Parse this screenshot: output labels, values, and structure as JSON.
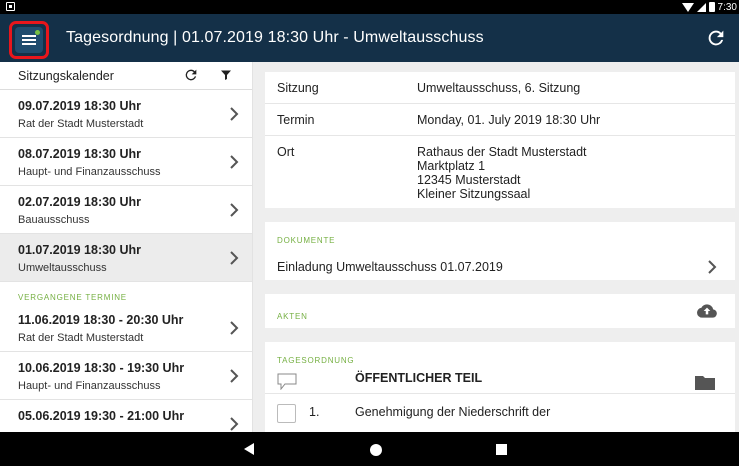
{
  "status_bar": {
    "time": "7:30"
  },
  "app_bar": {
    "title": "Tagesordnung | 01.07.2019 18:30 Uhr - Umweltausschuss"
  },
  "sidebar": {
    "title": "Sitzungskalender",
    "upcoming": [
      {
        "date": "09.07.2019 18:30 Uhr",
        "body": "Rat der Stadt Musterstadt"
      },
      {
        "date": "08.07.2019 18:30 Uhr",
        "body": "Haupt- und Finanzausschuss"
      },
      {
        "date": "02.07.2019 18:30 Uhr",
        "body": "Bauausschuss"
      },
      {
        "date": "01.07.2019 18:30 Uhr",
        "body": "Umweltausschuss",
        "selected": true
      }
    ],
    "past_label": "VERGANGENE TERMINE",
    "past": [
      {
        "date": "11.06.2019 18:30 - 20:30 Uhr",
        "body": "Rat der Stadt Musterstadt"
      },
      {
        "date": "10.06.2019 18:30 - 19:30 Uhr",
        "body": "Haupt- und Finanzausschuss"
      },
      {
        "date": "05.06.2019 19:30 - 21:00 Uhr",
        "body": ""
      }
    ]
  },
  "details": {
    "sitzung_label": "Sitzung",
    "sitzung_value": "Umweltausschuss, 6. Sitzung",
    "termin_label": "Termin",
    "termin_value": "Monday, 01. July 2019 18:30 Uhr",
    "ort_label": "Ort",
    "ort_lines": [
      "Rathaus der Stadt Musterstadt",
      "Marktplatz 1",
      "12345 Musterstadt",
      "Kleiner Sitzungssaal"
    ]
  },
  "documents": {
    "label": "DOKUMENTE",
    "items": [
      "Einladung Umweltausschuss 01.07.2019"
    ]
  },
  "akten": {
    "label": "AKTEN"
  },
  "agenda": {
    "label": "TAGESORDNUNG",
    "section_title": "ÖFFENTLICHER TEIL",
    "items": [
      {
        "number": "1.",
        "text": "Genehmigung der Niederschrift der"
      }
    ]
  },
  "colors": {
    "app_bar": "#143048",
    "accent_green": "#76b043",
    "highlight_red": "#e8161c",
    "selected_row": "#ececec",
    "panel_bg": "#eeeeee"
  },
  "icons": {
    "menu": "hamburger-menu-icon",
    "refresh": "refresh-icon",
    "filter": "filter-icon",
    "chevron": "chevron-right-icon",
    "cloud": "cloud-upload-icon",
    "speech": "speech-bubble-icon",
    "folder": "folder-icon"
  }
}
